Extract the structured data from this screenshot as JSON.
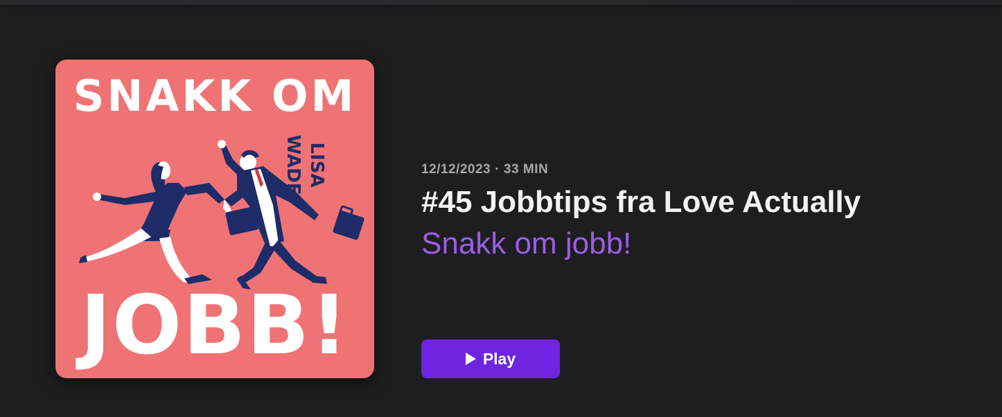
{
  "episode": {
    "date": "12/12/2023",
    "separator": "·",
    "duration": "33 MIN",
    "title": "#45 Jobbtips fra Love Actually",
    "show_name": "Snakk om jobb!",
    "play_label": "Play"
  },
  "artwork": {
    "top_text": "SNAKK OM",
    "bottom_text": "JOBB!",
    "side_text": "LISA WADE",
    "background_color": "#ef7375",
    "figure_color": "#1e2c68"
  },
  "colors": {
    "background": "#1e1e1f",
    "accent": "#6e24e0",
    "link": "#9d5ce8",
    "meta_text": "#a6a6ab",
    "title_text": "#f2f2f4"
  }
}
